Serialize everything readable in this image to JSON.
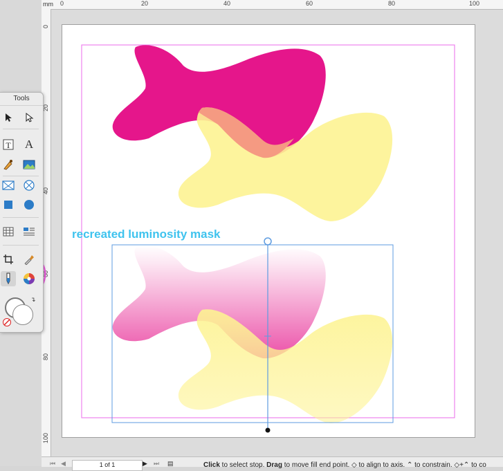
{
  "ruler": {
    "unit": "mm",
    "top_labels": [
      "0",
      "20",
      "40",
      "60",
      "80",
      "100"
    ],
    "left_labels": [
      "0",
      "20",
      "40",
      "60",
      "80",
      "100"
    ]
  },
  "tools_palette": {
    "title": "Tools",
    "items": [
      {
        "name": "selection-tool",
        "icon": "arrow"
      },
      {
        "name": "direct-selection-tool",
        "icon": "hollow-arrow"
      },
      {
        "name": "text-tool",
        "icon": "T-box"
      },
      {
        "name": "type-tool",
        "icon": "A"
      },
      {
        "name": "pen-tool",
        "icon": "pen"
      },
      {
        "name": "image-tool",
        "icon": "picture"
      },
      {
        "name": "image-frame-tool",
        "icon": "x-box"
      },
      {
        "name": "ellipse-frame-tool",
        "icon": "x-circle"
      },
      {
        "name": "rectangle-tool",
        "icon": "square"
      },
      {
        "name": "ellipse-tool",
        "icon": "circle"
      },
      {
        "name": "table-tool",
        "icon": "grid"
      },
      {
        "name": "text-table-tool",
        "icon": "table"
      },
      {
        "name": "crop-tool",
        "icon": "crop"
      },
      {
        "name": "eyedropper-tool",
        "icon": "dropper"
      },
      {
        "name": "fill-tool",
        "icon": "fill"
      },
      {
        "name": "color-picker-tool",
        "icon": "color-wheel"
      }
    ]
  },
  "canvas": {
    "caption": "recreated luminosity mask",
    "colors": {
      "magenta": "#e5168b",
      "yellow": "#fdf392",
      "overlap": "#f59a82",
      "caption": "#3fc3ee",
      "guide": "#ee82ee",
      "selection": "#5d9be0"
    }
  },
  "status_bar": {
    "page_indicator": "1 of 1",
    "help_parts": [
      {
        "bold": "Click",
        "text": " to select stop. "
      },
      {
        "bold": "Drag",
        "text": " to move fill end point. "
      },
      {
        "bold": "",
        "text": "◇ to align to axis. ⌃ to constrain. ◇+⌃ to co"
      }
    ]
  }
}
